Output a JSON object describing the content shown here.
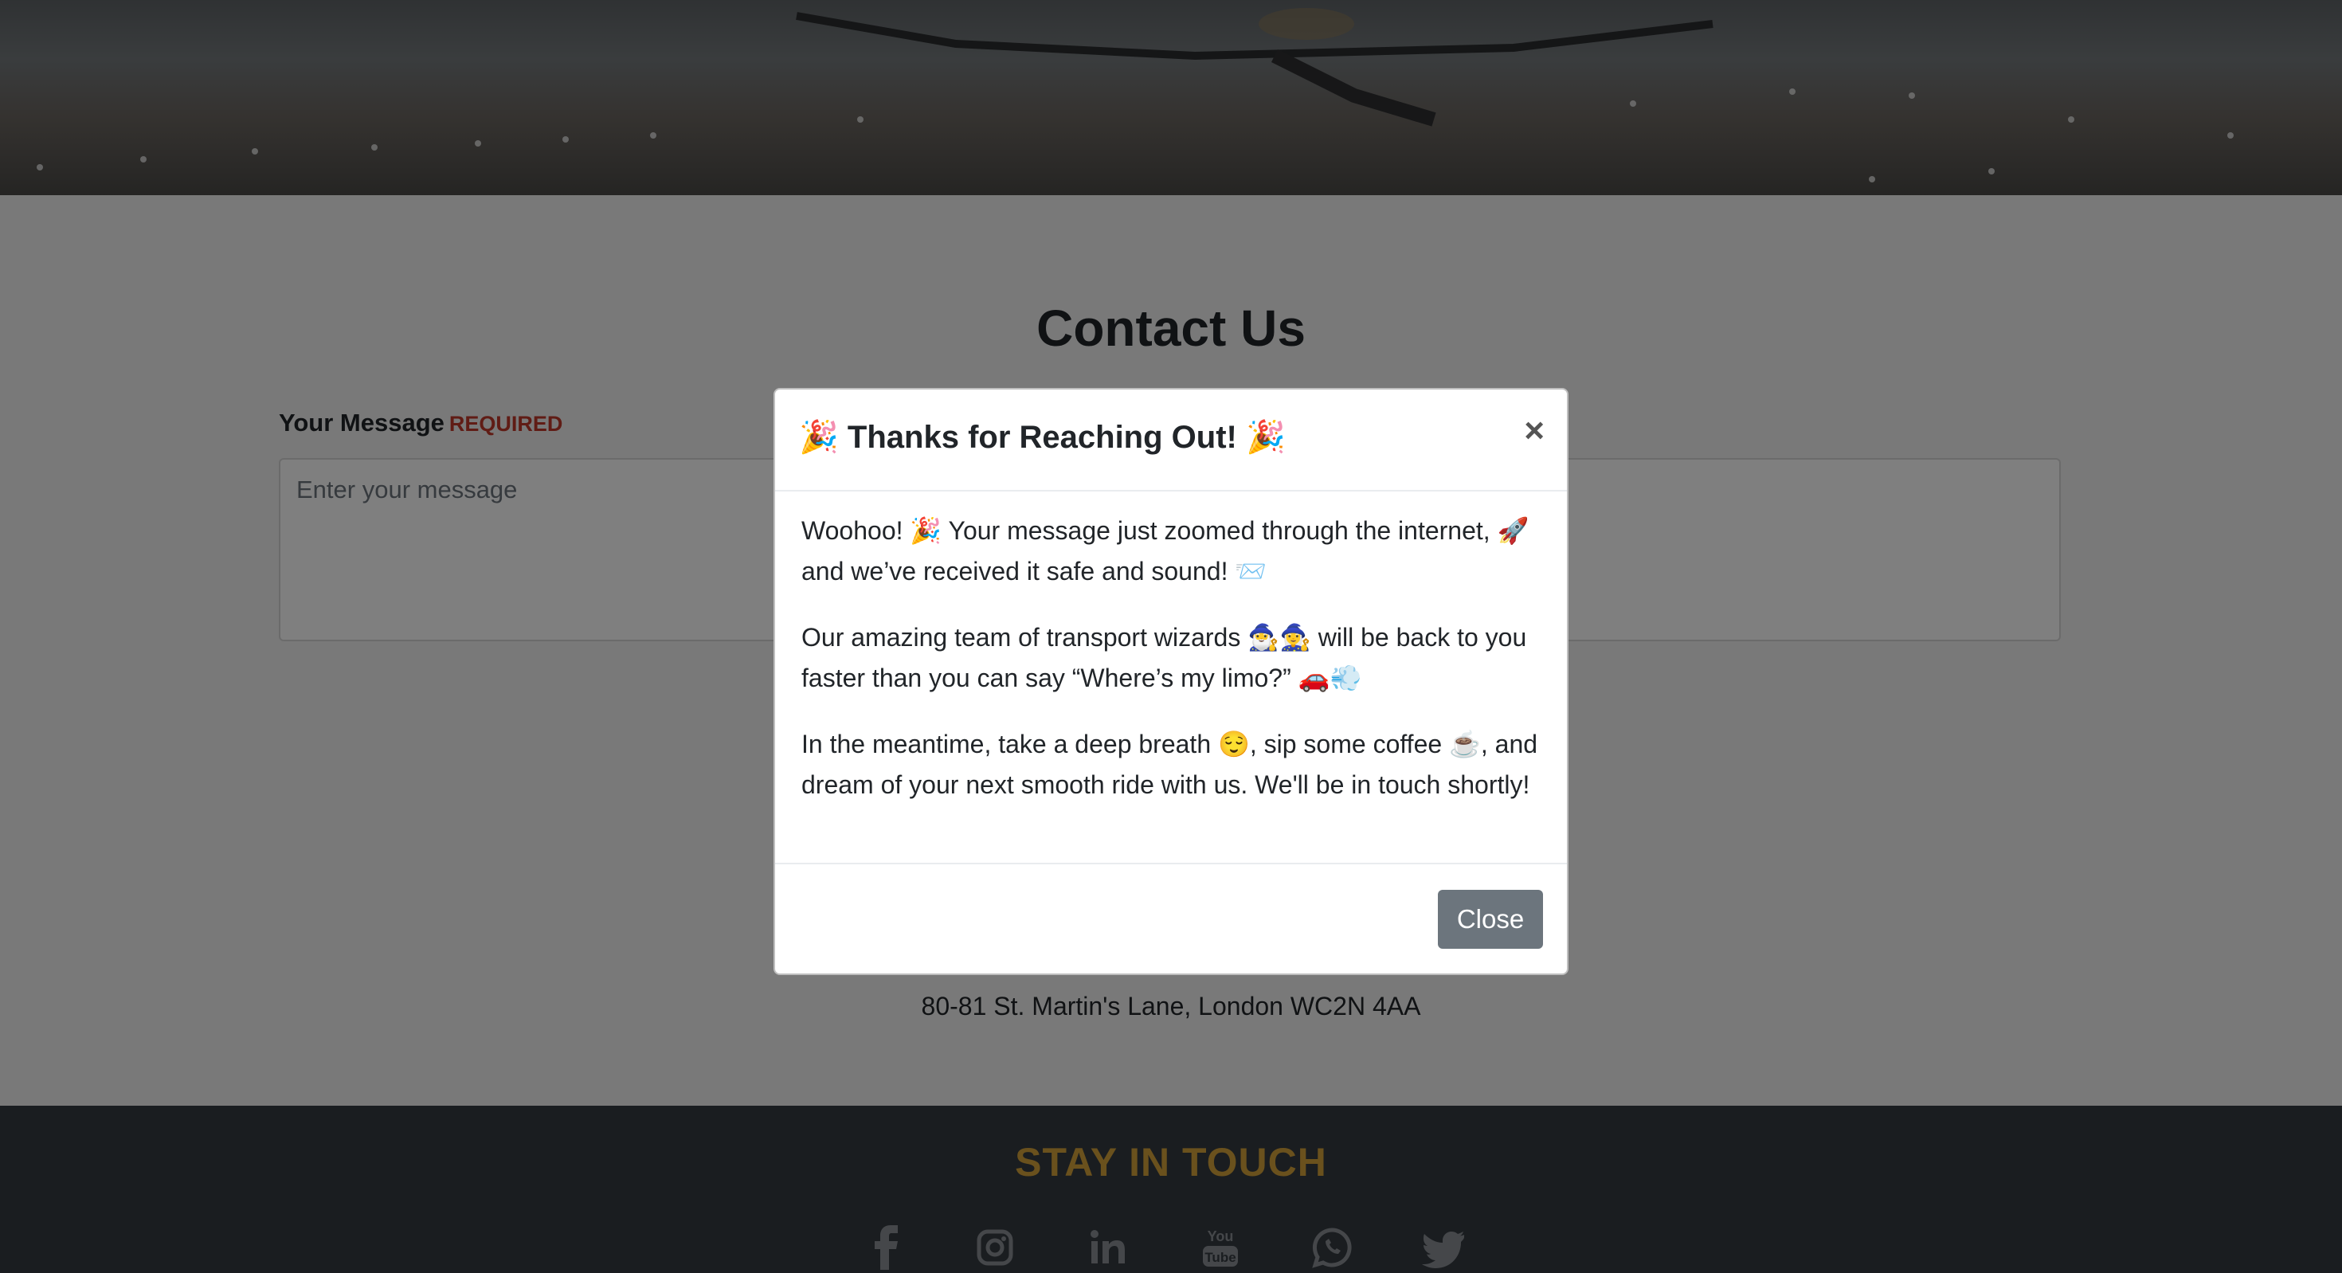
{
  "contact": {
    "title": "Contact Us",
    "message_label": "Your Message",
    "required_label": "REQUIRED",
    "message_placeholder": "Enter your message",
    "address": "80-81 St. Martin's Lane, London WC2N 4AA"
  },
  "footer": {
    "title": "STAY IN TOUCH",
    "social_icons": [
      "facebook-icon",
      "instagram-icon",
      "linkedin-icon",
      "youtube-icon",
      "whatsapp-icon",
      "twitter-icon"
    ]
  },
  "modal": {
    "title": "🎉 Thanks for Reaching Out! 🎉",
    "close_x": "×",
    "paragraphs": [
      "Woohoo! 🎉 Your message just zoomed through the internet, 🚀 and we’ve received it safe and sound! 📨",
      "Our amazing team of transport wizards 🧙‍♂️🧙‍♀️ will be back to you faster than you can say “Where’s my limo?” 🚗💨",
      "In the meantime, take a deep breath 😌, sip some coffee ☕, and dream of your next smooth ride with us. We'll be in touch shortly!"
    ],
    "close_button": "Close"
  },
  "colors": {
    "accent_gold": "#d4a23a",
    "required_red": "#c0392b",
    "footer_bg": "#343a40",
    "button_gray": "#6c757d"
  }
}
